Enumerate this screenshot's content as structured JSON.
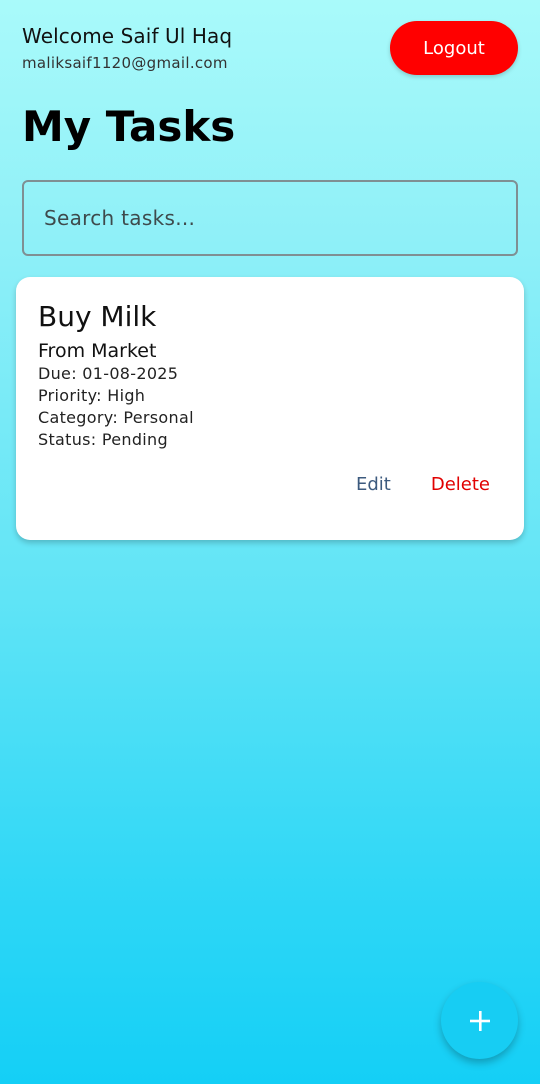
{
  "header": {
    "welcome": "Welcome Saif Ul Haq",
    "email": "maliksaif1120@gmail.com",
    "logout_label": "Logout"
  },
  "page": {
    "title": "My Tasks"
  },
  "search": {
    "placeholder": "Search tasks...",
    "value": ""
  },
  "tasks": [
    {
      "title": "Buy Milk",
      "description": "From Market",
      "due": "Due: 01-08-2025",
      "priority": "Priority: High",
      "category": "Category: Personal",
      "status": "Status: Pending",
      "edit_label": "Edit",
      "delete_label": "Delete"
    }
  ],
  "fab": {
    "icon": "plus-icon"
  },
  "colors": {
    "logout": "#ff0000",
    "delete": "#e10000",
    "edit": "#3c5a7e",
    "fab": "#17cdf3",
    "background_top": "#a9fafa",
    "background_bottom": "#14cff6"
  }
}
